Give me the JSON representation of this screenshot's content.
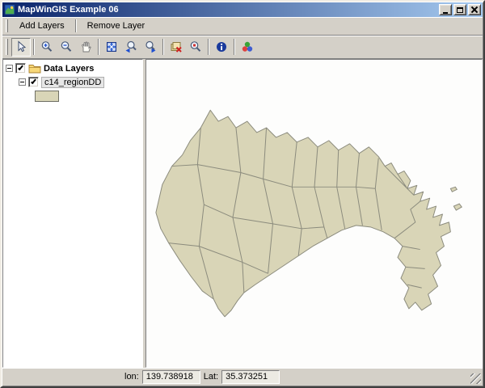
{
  "window": {
    "title": "MapWinGIS Example 06"
  },
  "menubar": {
    "items": [
      {
        "label": "Add Layers"
      },
      {
        "label": "Remove Layer"
      }
    ]
  },
  "toolbar": {
    "buttons": [
      {
        "name": "select-cursor",
        "icon": "pointer-icon",
        "pressed": true
      },
      {
        "name": "zoom-in",
        "icon": "magnifier-plus-icon"
      },
      {
        "name": "zoom-out",
        "icon": "magnifier-minus-icon"
      },
      {
        "name": "pan",
        "icon": "hand-icon"
      },
      {
        "name": "zoom-full-extent",
        "icon": "expand-arrows-icon"
      },
      {
        "name": "zoom-previous",
        "icon": "magnifier-back-icon"
      },
      {
        "name": "zoom-next",
        "icon": "magnifier-forward-icon"
      },
      {
        "name": "remove-layer",
        "icon": "layer-remove-icon"
      },
      {
        "name": "zoom-to-selection",
        "icon": "magnifier-red-icon"
      },
      {
        "name": "identify",
        "icon": "info-icon"
      },
      {
        "name": "symbology",
        "icon": "palette-icon"
      }
    ]
  },
  "layers_panel": {
    "root": {
      "label": "Data Layers",
      "checked": true,
      "expanded": true
    },
    "children": [
      {
        "label": "c14_regionDD",
        "checked": true,
        "expanded": true,
        "swatch_color": "#d9d5b7"
      }
    ]
  },
  "statusbar": {
    "lon_label": "lon:",
    "lon_value": "139.738918",
    "lat_label": "Lat:",
    "lat_value": "35.373251"
  },
  "colors": {
    "map-fill": "#d9d5b7",
    "map-stroke": "#8b8b7d",
    "map-bg": "#fdfdfc",
    "titlebar-start": "#0a246a",
    "titlebar-end": "#a6caf0",
    "chrome": "#d4d0c8"
  }
}
